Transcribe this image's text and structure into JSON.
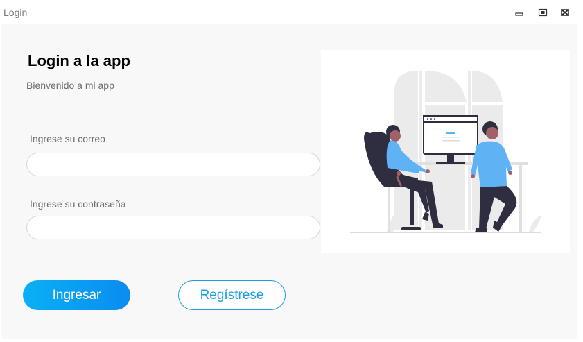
{
  "window": {
    "title": "Login",
    "controls": [
      "minimize-icon",
      "restore-icon",
      "close-icon"
    ]
  },
  "form": {
    "heading": "Login a la app",
    "subheading": "Bienvenido a mi app",
    "email_label": "Ingrese su correo",
    "email_value": "",
    "email_placeholder": "",
    "password_label": "Ingrese su contraseña",
    "password_value": "",
    "password_placeholder": ""
  },
  "actions": {
    "login_label": "Ingresar",
    "register_label": "Regístrese"
  },
  "illustration": {
    "icon": "people-at-computer-illustration"
  },
  "colors": {
    "accent": "#0a9bf3",
    "accent_border": "#1a9fe0",
    "panel_bg": "#f7f8f7",
    "shirt": "#5fb3f5",
    "dark": "#2f2e41"
  }
}
